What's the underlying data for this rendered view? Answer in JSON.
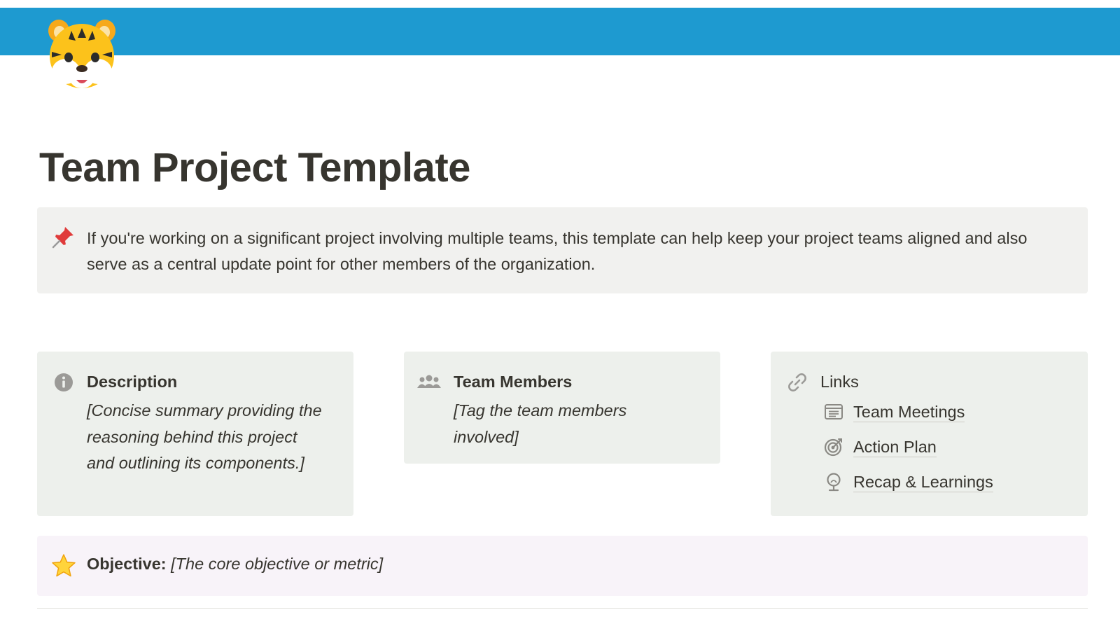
{
  "page": {
    "title": "Team Project Template",
    "cover_color": "#1e9ad0",
    "icon": "tiger-face-icon"
  },
  "intro_callout": {
    "icon": "pushpin-icon",
    "text": "If you're working on a significant project involving multiple teams, this template can help keep your project teams aligned and also serve as a central update point for other members of the organization."
  },
  "cards": {
    "description": {
      "icon": "info-icon",
      "heading": "Description",
      "body": "[Concise summary providing the reasoning behind this project and outlining its components.]"
    },
    "team_members": {
      "icon": "people-icon",
      "heading": "Team Members",
      "body": "[Tag the team members involved]"
    },
    "links": {
      "icon": "link-icon",
      "heading": "Links",
      "items": [
        {
          "label": "Team Meetings",
          "icon": "document-list-icon"
        },
        {
          "label": "Action Plan",
          "icon": "target-icon"
        },
        {
          "label": "Recap & Learnings",
          "icon": "lightbulb-icon"
        }
      ]
    }
  },
  "objective": {
    "icon": "star-icon",
    "label": "Objective:",
    "value": "[The core objective or metric]"
  },
  "colors": {
    "callout_gray": "#f1f1ef",
    "card_green": "#edf0ec",
    "objective_purple": "#f8f3f9",
    "text": "#37352f"
  }
}
